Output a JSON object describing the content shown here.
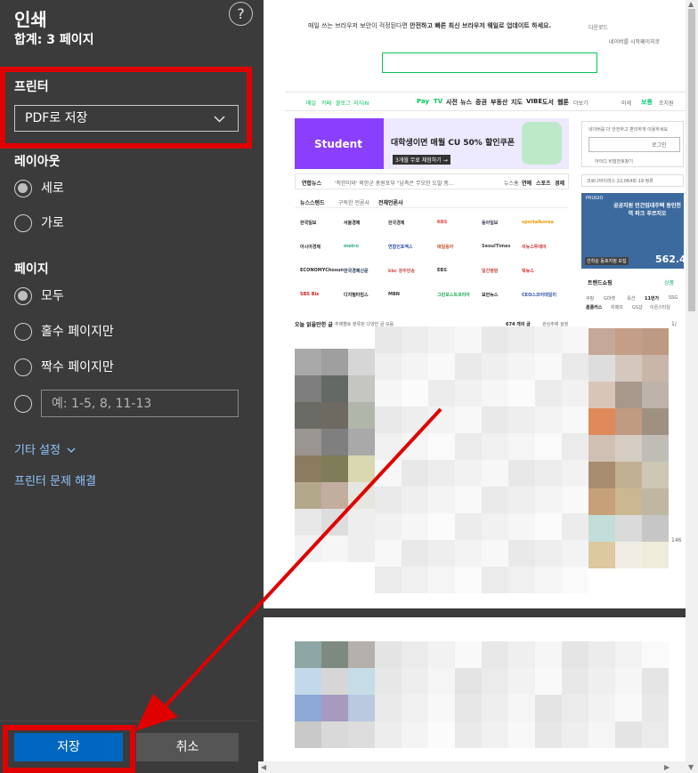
{
  "dialog": {
    "title": "인쇄",
    "total_pages": "합계: 3 페이지",
    "help_glyph": "?"
  },
  "printer": {
    "label": "프린터",
    "selected": "PDF로 저장"
  },
  "layout": {
    "label": "레이아웃",
    "options": [
      {
        "label": "세로",
        "selected": true
      },
      {
        "label": "가로",
        "selected": false
      }
    ]
  },
  "pages": {
    "label": "페이지",
    "options": [
      {
        "label": "모두",
        "selected": true
      },
      {
        "label": "홀수 페이지만",
        "selected": false
      },
      {
        "label": "짝수 페이지만",
        "selected": false
      }
    ],
    "custom_placeholder": "예: 1-5, 8, 11-13"
  },
  "links": {
    "more_settings": "기타 설정",
    "troubleshoot": "프린터 문제 해결"
  },
  "buttons": {
    "save": "저장",
    "cancel": "취소"
  },
  "preview": {
    "notice_prefix": "매일 쓰는 브라우저 보안이 걱정된다면 ",
    "notice_bold": "안전하고 빠른 최신 브라우저 웨일로 업데이트 하세요.",
    "notice_right": "다운로드",
    "notice_sub": "네이버를 시작페이지로",
    "nav_left": [
      "메일",
      "카페",
      "블로그",
      "지식iN"
    ],
    "nav_mid": [
      "Pay",
      "TV",
      "사전",
      "뉴스",
      "증권",
      "부동산",
      "지도",
      "VIBE",
      "도서",
      "웹툰",
      "더보기"
    ],
    "nav_right": [
      "미세",
      "보통",
      "조치원"
    ],
    "banner_brand": "Student",
    "banner_head": "대학생이면 매월 CU 50% 할인쿠폰",
    "banner_btn": "3개월 무료 체험하기 →",
    "login_text": "네이버를 더 안전하고 편리하게 이용하세요",
    "login_btn": "로그인",
    "login_links": "아이디  비밀번호찾기",
    "news_source": "연합뉴스",
    "news_headline": "'착한미와' 북한군 총원포부 \"남측은 무모한 도발 중...",
    "news_tabs": [
      "뉴스홈",
      "연예",
      "스포츠",
      "경제"
    ],
    "newsstand": "뉴스스탠드",
    "newsstand_sub": "구독한 언론사",
    "newsstand_all": "전체언론사",
    "press": [
      "한국일보",
      "서울경제",
      "한국경제",
      "KBS",
      "동아일보",
      "sportalkorea",
      "아시아경제",
      "metro",
      "연합인포맥스",
      "매일동아",
      "SeoulTimes",
      "이뉴스투데이",
      "ECONOMYChosun",
      "한국경제신문",
      "kbc 광주방송",
      "EBS",
      "일간병원",
      "빅뉴스",
      "SBS Biz",
      "디지털타임스",
      "MBN",
      "그린포스트코리아",
      "보안뉴스",
      "CEO스코어데일리"
    ],
    "ad_title": "공공지원 민간임대주택 동인천역 파크 푸르지오",
    "ad_brand": "PRUGIO",
    "ad_price": "562.4",
    "ad_price_prefix": "선착순 동호지정 모집",
    "ad_sub": "코로나바이러스 22,064회-19 정류",
    "ad_tag": "이벤트",
    "shopping": "트렌드쇼핑",
    "shopping_right": "상품",
    "shopping_row1": [
      "쿠팡",
      "G마켓",
      "옥션",
      "11번가",
      "SSG"
    ],
    "shopping_row2": [
      "홈플러스",
      "위메프",
      "GS샵",
      "이온스타일"
    ],
    "section_title": "오늘 읽을만한 글",
    "section_sub": "주제별로 분류된 다양한 글 모음",
    "section_count": "674 개의 글",
    "section_settings": "관심주제 설정",
    "right_num1": "1/",
    "right_num2": "146"
  }
}
